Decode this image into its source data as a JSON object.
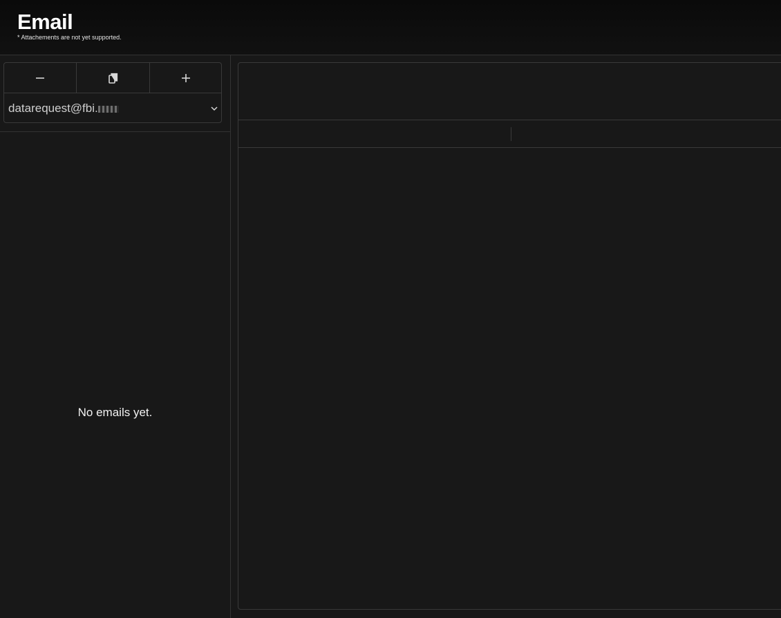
{
  "header": {
    "title": "Email",
    "note": "* Attachements are not yet supported."
  },
  "toolbar": {
    "buttons": [
      {
        "icon": "minus-icon"
      },
      {
        "icon": "copy-icon"
      },
      {
        "icon": "plus-icon"
      }
    ]
  },
  "account": {
    "selected": "datarequest@fbi."
  },
  "email_list": {
    "empty_message": "No emails yet."
  },
  "colors": {
    "background": "#181818",
    "header_bg": "#0a0a0a",
    "border": "#3a3a3a",
    "text": "#ffffff"
  }
}
